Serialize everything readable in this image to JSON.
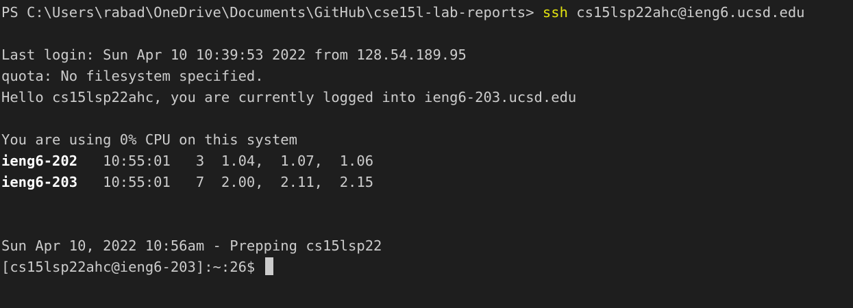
{
  "colors": {
    "background": "#1e1e1e",
    "text": "#cccccc",
    "command": "#e5e510",
    "bold_host": "#ffffff",
    "cursor": "#cccccc"
  },
  "terminal": {
    "prompt_line": {
      "prompt": "PS C:\\Users\\rabad\\OneDrive\\Documents\\GitHub\\cse15l-lab-reports> ",
      "command": "ssh",
      "args": " cs15lsp22ahc@ieng6.ucsd.edu"
    },
    "last_login": "Last login: Sun Apr 10 10:39:53 2022 from 128.54.189.95",
    "quota": "quota: No filesystem specified.",
    "hello": "Hello cs15lsp22ahc, you are currently logged into ieng6-203.ucsd.edu",
    "cpu_usage": "You are using 0% CPU on this system",
    "hosts": [
      {
        "name": "ieng6-202",
        "stats": "   10:55:01   3  1.04,  1.07,  1.06"
      },
      {
        "name": "ieng6-203",
        "stats": "   10:55:01   7  2.00,  2.11,  2.15"
      }
    ],
    "prepping": "Sun Apr 10, 2022 10:56am - Prepping cs15lsp22",
    "shell_prompt": "[cs15lsp22ahc@ieng6-203]:~:26$ "
  }
}
